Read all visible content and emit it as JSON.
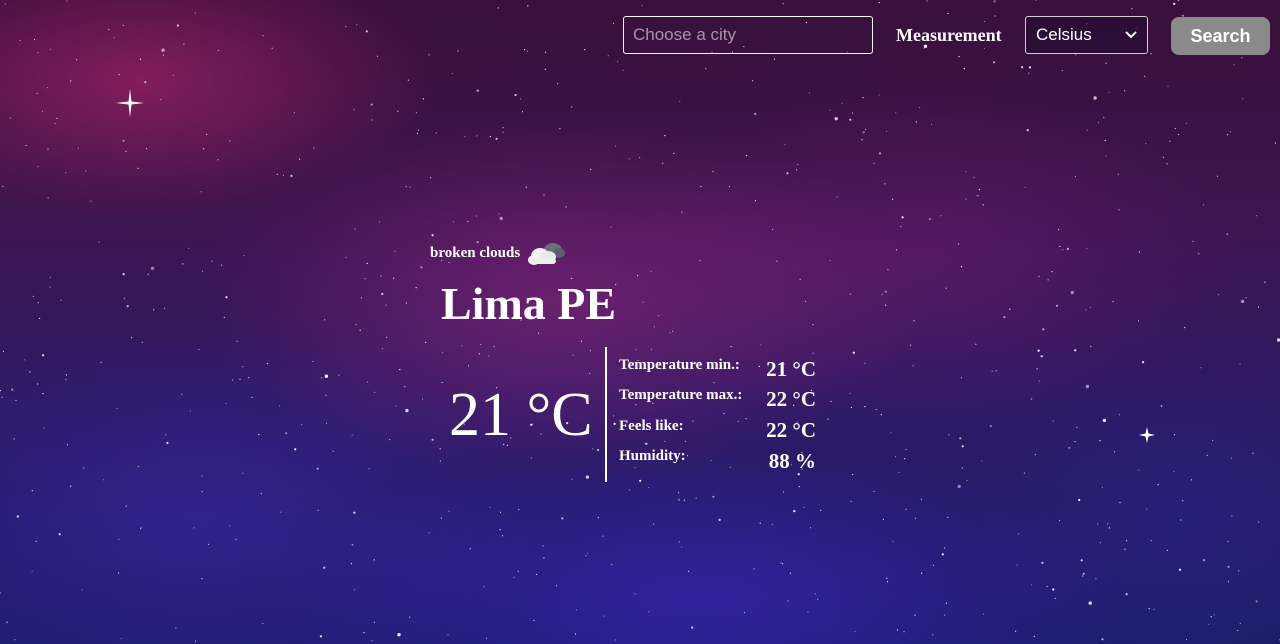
{
  "search": {
    "placeholder": "Choose a city",
    "value": ""
  },
  "measurement": {
    "label": "Measurement",
    "selected": "Celsius"
  },
  "search_button": {
    "label": "Search",
    "color": "#8a8a8a"
  },
  "weather": {
    "condition": "broken clouds",
    "condition_icon": "broken-clouds-icon",
    "city": "Lima PE",
    "temperature": "21 °C",
    "stats": [
      {
        "label": "Temperature min.:",
        "value": "21 °C"
      },
      {
        "label": "Temperature max.:",
        "value": "22 °C"
      },
      {
        "label": "Feels like:",
        "value": "22 °C"
      },
      {
        "label": "Humidity:",
        "value": "88 %"
      }
    ]
  }
}
